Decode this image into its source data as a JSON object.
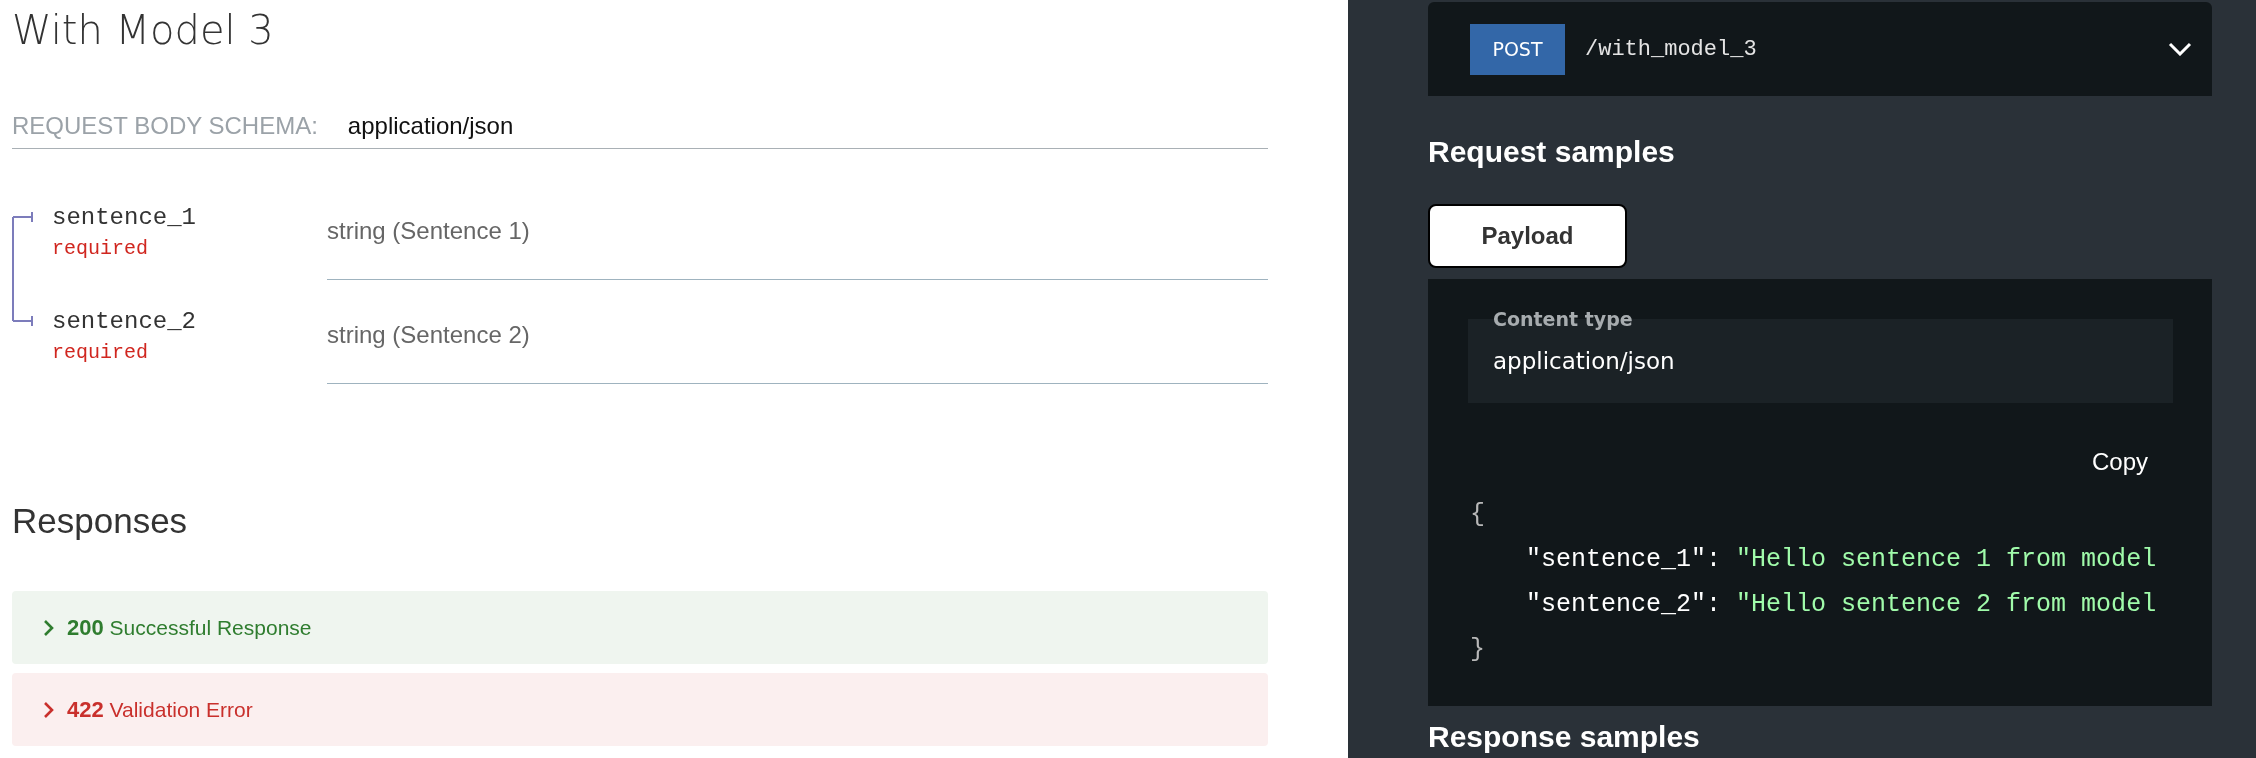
{
  "operation": {
    "title": "With Model 3"
  },
  "request_body": {
    "label": "REQUEST BODY SCHEMA:",
    "content_type": "application/json",
    "fields": [
      {
        "name": "sentence_1",
        "requirement": "required",
        "type": "string (Sentence 1)"
      },
      {
        "name": "sentence_2",
        "requirement": "required",
        "type": "string (Sentence 2)"
      }
    ]
  },
  "responses": {
    "title": "Responses",
    "items": [
      {
        "code": "200",
        "description": "Successful Response",
        "kind": "success",
        "expanded": false
      },
      {
        "code": "422",
        "description": "Validation Error",
        "kind": "error",
        "expanded": false
      }
    ]
  },
  "right_panel": {
    "endpoint": {
      "method": "POST",
      "path": "/with_model_3",
      "expanded": false
    },
    "request_samples": {
      "title": "Request samples",
      "tabs": [
        {
          "label": "Payload",
          "selected": true
        }
      ],
      "content_type_label": "Content type",
      "content_type": "application/json",
      "copy_label": "Copy",
      "code": {
        "open": "{",
        "entries": [
          {
            "key": "\"sentence_1\":",
            "value": "\"Hello sentence 1 from model"
          },
          {
            "key": "\"sentence_2\":",
            "value": "\"Hello sentence 2 from model"
          }
        ],
        "close": "}"
      }
    },
    "response_samples": {
      "title": "Response samples"
    }
  }
}
